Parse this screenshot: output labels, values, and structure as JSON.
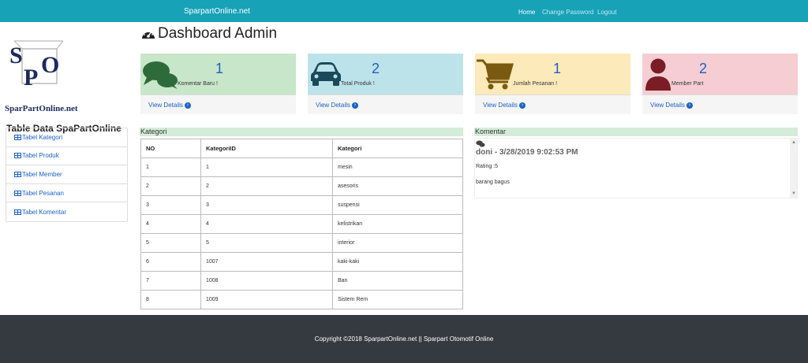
{
  "navbar": {
    "brand": "SparpartOnline.net",
    "links": [
      "Home",
      "Change Password",
      "Logout"
    ]
  },
  "sidebar": {
    "logo_letters": "SPO",
    "logo_text": "SparPartOnline.net",
    "title": "Table Data SpaPartOnline",
    "items": [
      "Tabel Kategori",
      "Tabel Produk",
      "Tabel Member",
      "Tabel Pesanan",
      "Tabel Komentar"
    ]
  },
  "page": {
    "title": "Dashboard Admin"
  },
  "cards": [
    {
      "count": "1",
      "label": "Komentar Baru !",
      "link": "View Details",
      "color": "#c8e6c9",
      "icon": "comments-icon"
    },
    {
      "count": "2",
      "label": "Total Produk !",
      "link": "View Details",
      "color": "#bde3ea",
      "icon": "car-icon"
    },
    {
      "count": "1",
      "label": "Jumlah Pesanan !",
      "link": "View Details",
      "color": "#fdeaba",
      "icon": "shopping-cart-icon"
    },
    {
      "count": "2",
      "label": "Member Part",
      "link": "View Details",
      "color": "#f5cdd3",
      "icon": "user-icon"
    }
  ],
  "kategori": {
    "heading": "Kategori",
    "columns": [
      "NO",
      "KategoriID",
      "Kategori"
    ],
    "rows": [
      [
        "1",
        "1",
        "mesin"
      ],
      [
        "2",
        "2",
        "asesoris"
      ],
      [
        "3",
        "3",
        "suspensi"
      ],
      [
        "4",
        "4",
        "kelistrikan"
      ],
      [
        "5",
        "5",
        "interior"
      ],
      [
        "6",
        "1007",
        "kaki-kaki"
      ],
      [
        "7",
        "1008",
        "Ban"
      ],
      [
        "8",
        "1009",
        "Sistem Rem"
      ]
    ]
  },
  "komentar": {
    "heading": "Komentar",
    "name": "doni - 3/28/2019 9:02:53 PM",
    "rating": "Rating :5",
    "text": "barang bagus"
  },
  "footer": {
    "text": "Copyright ©2018 SparpartOnline.net || Sparpart Otomotif Online"
  },
  "colors": {
    "navbar": "#17a2b8",
    "link": "#1a62c7",
    "footer": "#343a40",
    "section_header": "#d4edda"
  }
}
